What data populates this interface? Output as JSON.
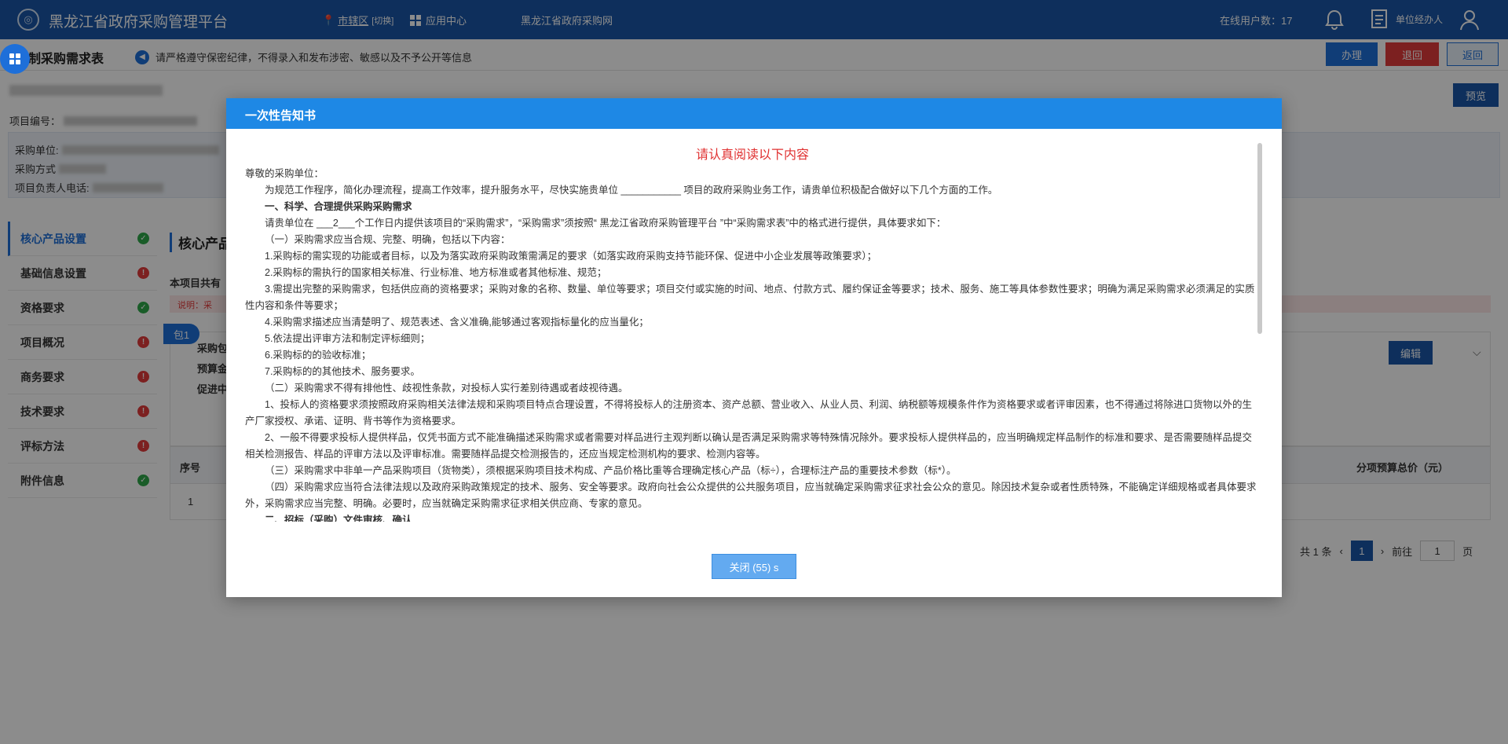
{
  "topbar": {
    "app_title": "黑龙江省政府采购管理平台",
    "region": "市辖区",
    "region_switch": "[切换]",
    "app_center": "应用中心",
    "site_link": "黑龙江省政府采购网",
    "online_users": "在线用户数：17",
    "role": "单位经办人"
  },
  "subheader": {
    "form_title": "制采购需求表",
    "notice": "请严格遵守保密纪律，不得录入和发布涉密、敏感以及不予公开等信息",
    "btn_handle": "办理",
    "btn_back": "退回",
    "btn_return": "返回",
    "btn_preview": "预览"
  },
  "project": {
    "code_label": "项目编号：",
    "unit_label": "采购单位:",
    "method_label": "采购方式",
    "phone_label": "项目负责人电话:"
  },
  "leftnav": [
    {
      "label": "核心产品设置",
      "status": "ok"
    },
    {
      "label": "基础信息设置",
      "status": "err"
    },
    {
      "label": "资格要求",
      "status": "ok"
    },
    {
      "label": "项目概况",
      "status": "err"
    },
    {
      "label": "商务要求",
      "status": "err"
    },
    {
      "label": "技术要求",
      "status": "err"
    },
    {
      "label": "评标方法",
      "status": "err"
    },
    {
      "label": "附件信息",
      "status": "ok"
    }
  ],
  "main": {
    "title": "核心产品",
    "pkg_count": "本项目共有",
    "warn": "说明：采",
    "pkg_tag": "包1",
    "pkg_lbl1": "采购包",
    "pkg_lbl2": "预算金",
    "pkg_lbl3": "促进中",
    "btn_edit": "编辑",
    "col_no": "序号",
    "col_total": "分项预算总价（元）",
    "row_no": "1",
    "pager_total": "共 1 条",
    "pager_cur": "1",
    "pager_goto": "前往",
    "pager_input": "1",
    "pager_unit": "页"
  },
  "modal": {
    "title": "一次性告知书",
    "read_title": "请认真阅读以下内容",
    "greeting": "尊敬的采购单位：",
    "intro": "为规范工作程序，简化办理流程，提高工作效率，提升服务水平，尽快实施贵单位 ___________ 项目的政府采购业务工作，请贵单位积极配合做好以下几个方面的工作。",
    "s1": "一、科学、合理提供采购采购需求",
    "s1_p": "请贵单位在 ___2___个工作日内提供该项目的“采购需求”，“采购需求”须按照“ 黑龙江省政府采购管理平台 ”中“采购需求表”中的格式进行提供，具体要求如下：",
    "s1_a": "（一）采购需求应当合规、完整、明确，包括以下内容：",
    "s1_a1": "1.采购标的需实现的功能或者目标，以及为落实政府采购政策需满足的要求（如落实政府采购支持节能环保、促进中小企业发展等政策要求）；",
    "s1_a2": "2.采购标的需执行的国家相关标准、行业标准、地方标准或者其他标准、规范；",
    "s1_a3": "3.需提出完整的采购需求，包括供应商的资格要求；采购对象的名称、数量、单位等要求；项目交付或实施的时间、地点、付款方式、履约保证金等要求；技术、服务、施工等具体参数性要求；明确为满足采购需求必须满足的实质性内容和条件等要求；",
    "s1_a4": "4.采购需求描述应当清楚明了、规范表述、含义准确,能够通过客观指标量化的应当量化；",
    "s1_a5": "5.依法提出评审方法和制定评标细则；",
    "s1_a6": "6.采购标的的验收标准；",
    "s1_a7": "7.采购标的的其他技术、服务要求。",
    "s1_b": "（二）采购需求不得有排他性、歧视性条款，对投标人实行差别待遇或者歧视待遇。",
    "s1_b1": "1、投标人的资格要求须按照政府采购相关法律法规和采购项目特点合理设置，不得将投标人的注册资本、资产总额、营业收入、从业人员、利润、纳税额等规模条件作为资格要求或者评审因素，也不得通过将除进口货物以外的生产厂家授权、承诺、证明、背书等作为资格要求。",
    "s1_b2": "2、一般不得要求投标人提供样品，仅凭书面方式不能准确描述采购需求或者需要对样品进行主观判断以确认是否满足采购需求等特殊情况除外。要求投标人提供样品的，应当明确规定样品制作的标准和要求、是否需要随样品提交相关检测报告、样品的评审方法以及评审标准。需要随样品提交检测报告的，还应当规定检测机构的要求、检测内容等。",
    "s1_c": "（三）采购需求中非单一产品采购项目（货物类），须根据采购项目技术构成、产品价格比重等合理确定核心产品（标÷），合理标注产品的重要技术参数（标*）。",
    "s1_d": "（四）采购需求应当符合法律法规以及政府采购政策规定的技术、服务、安全等要求。政府向社会公众提供的公共服务项目，应当就确定采购需求征求社会公众的意见。除因技术复杂或者性质特殊，不能确定详细规格或者具体要求外，采购需求应当完整、明确。必要时，应当就确定采购需求征求相关供应商、专家的意见。",
    "s2": "二、招标（采购）文件审核、确认",
    "close_btn": "关闭 (55) s"
  }
}
